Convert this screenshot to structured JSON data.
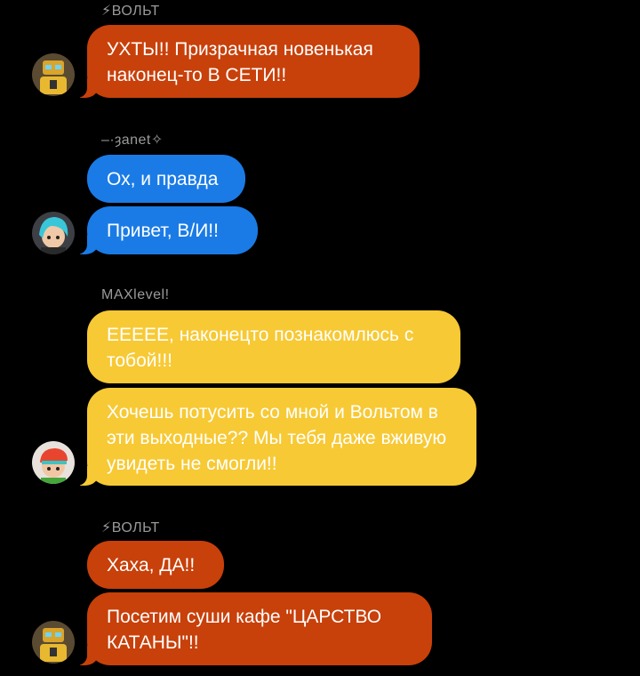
{
  "colors": {
    "background": "#000000",
    "volt_bubble": "#C8400A",
    "janet_bubble": "#1A7BE6",
    "max_bubble": "#F7C934",
    "sender_name": "#9A9A9A"
  },
  "groups": [
    {
      "sender": "⚡ВОЛЬТ",
      "avatar_icon": "robot-avatar",
      "messages": [
        "УХТЫ!! Призрачная новенькая наконец-то В СЕТИ!!"
      ]
    },
    {
      "sender": "–·ȝanet✧",
      "avatar_icon": "girl-cyan-hair-avatar",
      "messages": [
        "Ох, и правда",
        "Привет, В/И!!"
      ]
    },
    {
      "sender": "MAXlevel!",
      "avatar_icon": "boy-cap-avatar",
      "messages": [
        "ЕЕЕЕЕ, наконецто познакомлюсь с тобой!!!",
        "Хочешь потусить со мной и Вольтом в эти выходные?? Мы тебя даже вживую увидеть не смогли!!"
      ]
    },
    {
      "sender": "⚡ВОЛЬТ",
      "avatar_icon": "robot-avatar",
      "messages": [
        "Хаха, ДА!!",
        "Посетим суши кафе \"ЦАРСТВО КАТАНЫ\"!!"
      ]
    }
  ]
}
